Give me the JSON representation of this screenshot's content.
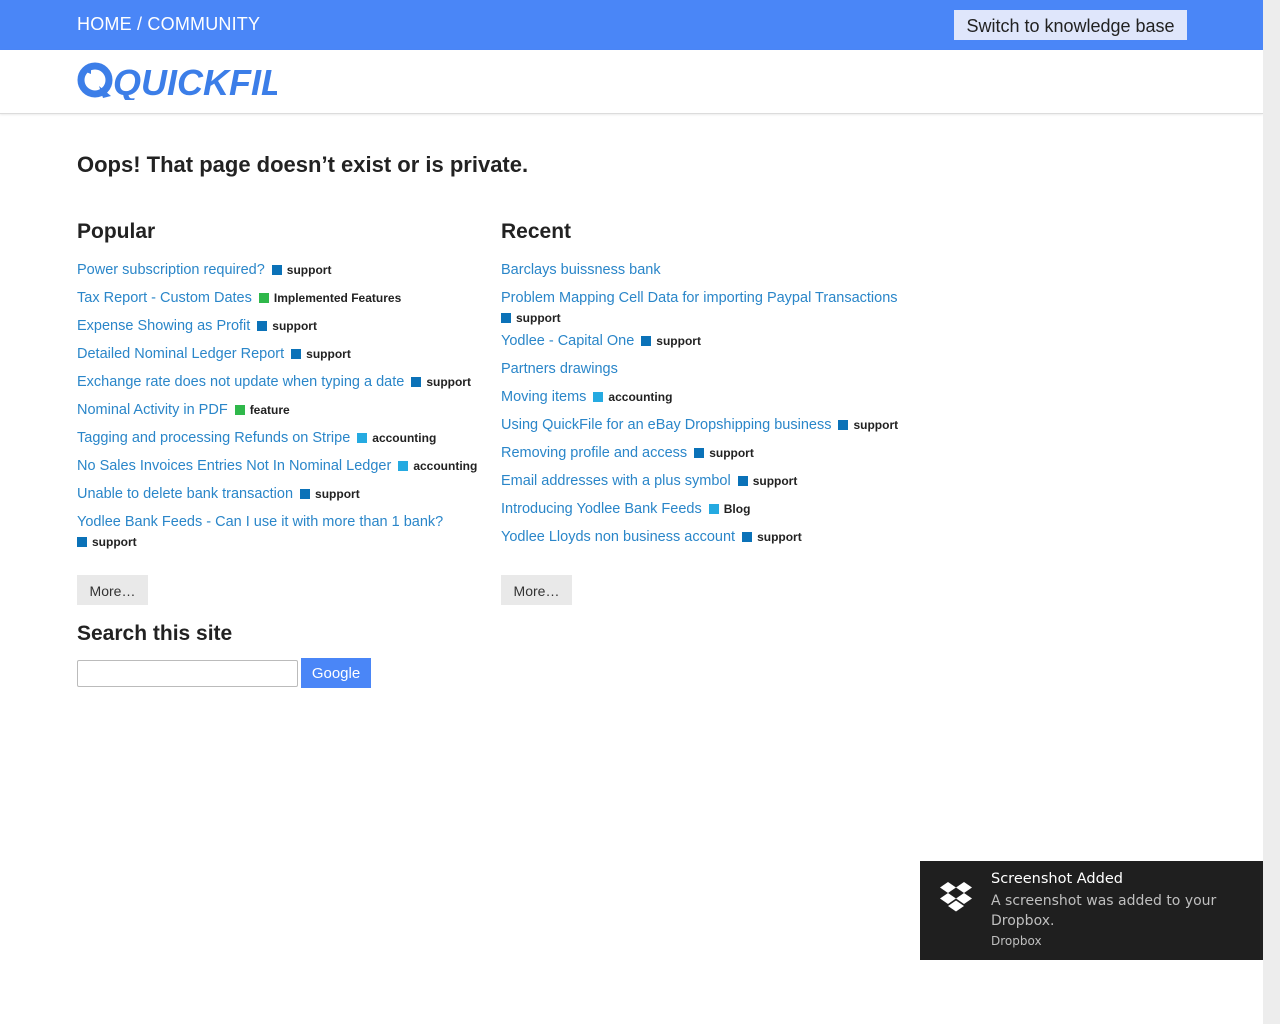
{
  "header": {
    "breadcrumb_home": "HOME",
    "breadcrumb_sep": " / ",
    "breadcrumb_community": "COMMUNITY",
    "switch_label": "Switch to knowledge base",
    "logo_text": "QUICKFILE"
  },
  "main": {
    "title": "Oops! That page doesn’t exist or is private."
  },
  "popular": {
    "heading": "Popular",
    "more_label": "More…",
    "items": [
      {
        "title": "Power subscription required?",
        "tag": "support"
      },
      {
        "title": "Tax Report - Custom Dates",
        "tag": "Implemented Features"
      },
      {
        "title": "Expense Showing as Profit",
        "tag": "support"
      },
      {
        "title": "Detailed Nominal Ledger Report",
        "tag": "support"
      },
      {
        "title": "Exchange rate does not update when typing a date",
        "tag": "support"
      },
      {
        "title": "Nominal Activity in PDF",
        "tag": "feature"
      },
      {
        "title": "Tagging and processing Refunds on Stripe",
        "tag": "accounting"
      },
      {
        "title": "No Sales Invoices Entries Not In Nominal Ledger",
        "tag": "accounting"
      },
      {
        "title": "Unable to delete bank transaction",
        "tag": "support"
      },
      {
        "title": "Yodlee Bank Feeds - Can I use it with more than 1 bank?",
        "tag": "support"
      }
    ]
  },
  "recent": {
    "heading": "Recent",
    "more_label": "More…",
    "items": [
      {
        "title": "Barclays buissness bank",
        "tag": ""
      },
      {
        "title": "Problem Mapping Cell Data for importing Paypal Transactions",
        "tag": "support"
      },
      {
        "title": "Yodlee - Capital One",
        "tag": "support"
      },
      {
        "title": "Partners drawings",
        "tag": ""
      },
      {
        "title": "Moving items",
        "tag": "accounting"
      },
      {
        "title": "Using QuickFile for an eBay Dropshipping business",
        "tag": "support"
      },
      {
        "title": "Removing profile and access",
        "tag": "support"
      },
      {
        "title": "Email addresses with a plus symbol",
        "tag": "support"
      },
      {
        "title": "Introducing Yodlee Bank Feeds",
        "tag": "Blog"
      },
      {
        "title": "Yodlee Lloyds non business account",
        "tag": "support"
      }
    ]
  },
  "search": {
    "heading": "Search this site",
    "input_value": "",
    "button_label": "Google"
  },
  "toast": {
    "title": "Screenshot Added",
    "body": "A screenshot was added to your Dropbox.",
    "source": "Dropbox"
  },
  "colors": {
    "brand_blue": "#4a86f7",
    "link_blue": "#2a86c9",
    "tag_support": "#0b72b8",
    "tag_implemented": "#2fb84b",
    "tag_feature": "#2fb84b",
    "tag_accounting": "#25aae1",
    "tag_blog": "#25aae1"
  }
}
